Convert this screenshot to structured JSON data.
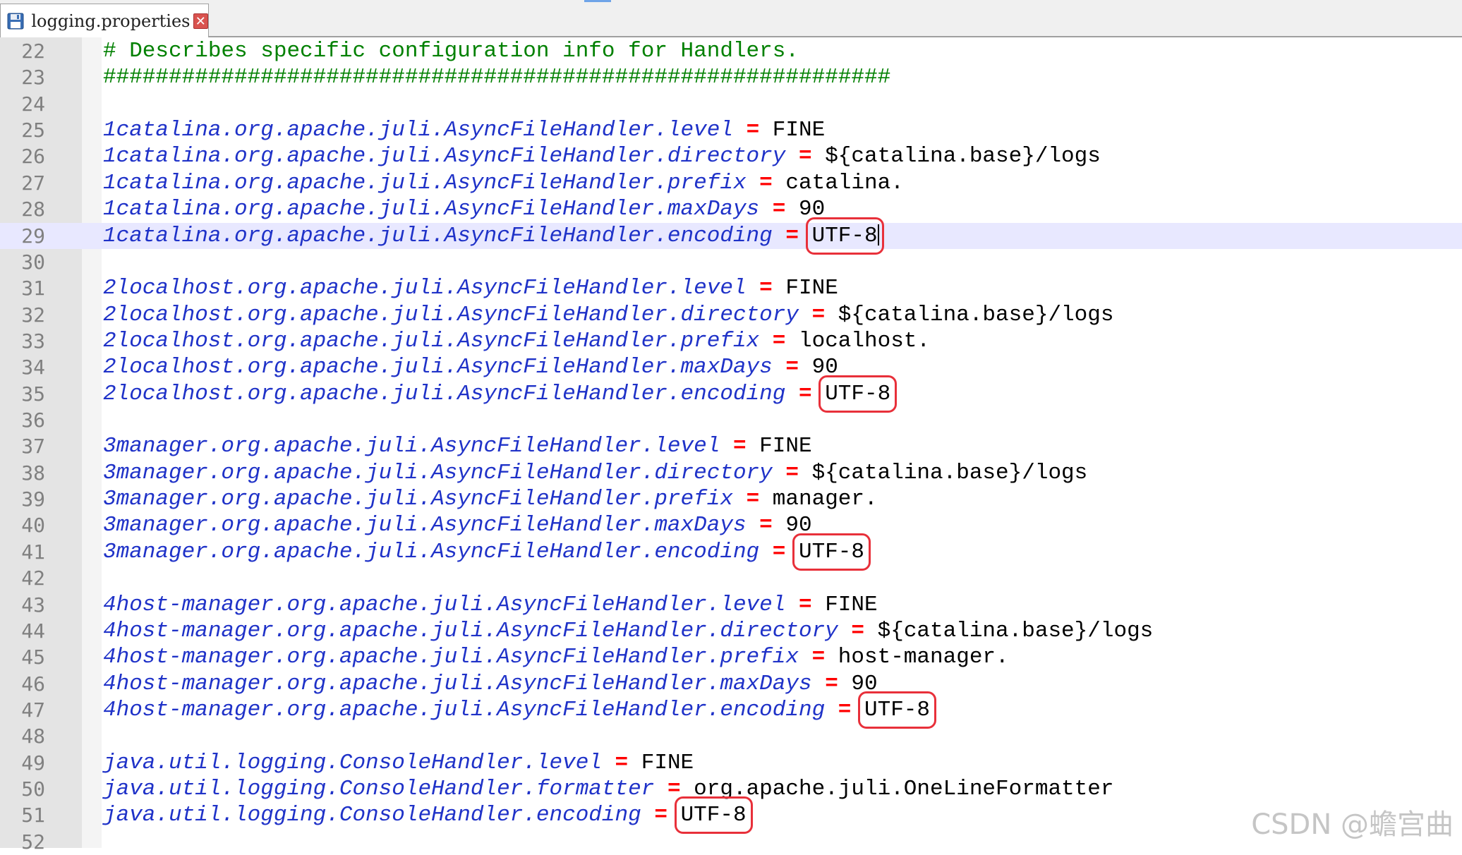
{
  "tab": {
    "icon": "floppy-disk-icon",
    "filename": "logging.properties",
    "close_icon": "close-icon"
  },
  "colors": {
    "comment": "#008000",
    "key": "#1f32c8",
    "operator": "#ff0000",
    "value": "#000000",
    "highlight_box": "#e8303a",
    "current_line": "#e8e8ff"
  },
  "lines": [
    {
      "n": "22",
      "type": "comment",
      "text": "# Describes specific configuration info for Handlers."
    },
    {
      "n": "23",
      "type": "comment",
      "text": "############################################################"
    },
    {
      "n": "24",
      "type": "blank"
    },
    {
      "n": "25",
      "type": "prop",
      "key": "1catalina.org.apache.juli.AsyncFileHandler.level",
      "op": "=",
      "value": "FINE"
    },
    {
      "n": "26",
      "type": "prop",
      "key": "1catalina.org.apache.juli.AsyncFileHandler.directory",
      "op": "=",
      "value": "${catalina.base}/logs"
    },
    {
      "n": "27",
      "type": "prop",
      "key": "1catalina.org.apache.juli.AsyncFileHandler.prefix",
      "op": "=",
      "value": "catalina."
    },
    {
      "n": "28",
      "type": "prop",
      "key": "1catalina.org.apache.juli.AsyncFileHandler.maxDays",
      "op": "=",
      "value": "90"
    },
    {
      "n": "29",
      "type": "prop",
      "key": "1catalina.org.apache.juli.AsyncFileHandler.encoding",
      "op": "=",
      "value": "UTF-8",
      "boxed": true,
      "current": true
    },
    {
      "n": "30",
      "type": "blank"
    },
    {
      "n": "31",
      "type": "prop",
      "key": "2localhost.org.apache.juli.AsyncFileHandler.level",
      "op": "=",
      "value": "FINE"
    },
    {
      "n": "32",
      "type": "prop",
      "key": "2localhost.org.apache.juli.AsyncFileHandler.directory",
      "op": "=",
      "value": "${catalina.base}/logs"
    },
    {
      "n": "33",
      "type": "prop",
      "key": "2localhost.org.apache.juli.AsyncFileHandler.prefix",
      "op": "=",
      "value": "localhost."
    },
    {
      "n": "34",
      "type": "prop",
      "key": "2localhost.org.apache.juli.AsyncFileHandler.maxDays",
      "op": "=",
      "value": "90"
    },
    {
      "n": "35",
      "type": "prop",
      "key": "2localhost.org.apache.juli.AsyncFileHandler.encoding",
      "op": "=",
      "value": "UTF-8",
      "boxed": true
    },
    {
      "n": "36",
      "type": "blank"
    },
    {
      "n": "37",
      "type": "prop",
      "key": "3manager.org.apache.juli.AsyncFileHandler.level",
      "op": "=",
      "value": "FINE"
    },
    {
      "n": "38",
      "type": "prop",
      "key": "3manager.org.apache.juli.AsyncFileHandler.directory",
      "op": "=",
      "value": "${catalina.base}/logs"
    },
    {
      "n": "39",
      "type": "prop",
      "key": "3manager.org.apache.juli.AsyncFileHandler.prefix",
      "op": "=",
      "value": "manager."
    },
    {
      "n": "40",
      "type": "prop",
      "key": "3manager.org.apache.juli.AsyncFileHandler.maxDays",
      "op": "=",
      "value": "90"
    },
    {
      "n": "41",
      "type": "prop",
      "key": "3manager.org.apache.juli.AsyncFileHandler.encoding",
      "op": "=",
      "value": "UTF-8",
      "boxed": true
    },
    {
      "n": "42",
      "type": "blank"
    },
    {
      "n": "43",
      "type": "prop",
      "key": "4host-manager.org.apache.juli.AsyncFileHandler.level",
      "op": "=",
      "value": "FINE"
    },
    {
      "n": "44",
      "type": "prop",
      "key": "4host-manager.org.apache.juli.AsyncFileHandler.directory",
      "op": "=",
      "value": "${catalina.base}/logs"
    },
    {
      "n": "45",
      "type": "prop",
      "key": "4host-manager.org.apache.juli.AsyncFileHandler.prefix",
      "op": "=",
      "value": "host-manager."
    },
    {
      "n": "46",
      "type": "prop",
      "key": "4host-manager.org.apache.juli.AsyncFileHandler.maxDays",
      "op": "=",
      "value": "90"
    },
    {
      "n": "47",
      "type": "prop",
      "key": "4host-manager.org.apache.juli.AsyncFileHandler.encoding",
      "op": "=",
      "value": "UTF-8",
      "boxed": true
    },
    {
      "n": "48",
      "type": "blank"
    },
    {
      "n": "49",
      "type": "prop",
      "key": "java.util.logging.ConsoleHandler.level",
      "op": "=",
      "value": "FINE"
    },
    {
      "n": "50",
      "type": "prop",
      "key": "java.util.logging.ConsoleHandler.formatter",
      "op": "=",
      "value": "org.apache.juli.OneLineFormatter"
    },
    {
      "n": "51",
      "type": "prop",
      "key": "java.util.logging.ConsoleHandler.encoding",
      "op": "=",
      "value": "UTF-8",
      "boxed": true
    },
    {
      "n": "52",
      "type": "blank"
    }
  ],
  "watermark": "CSDN @蟾宫曲"
}
